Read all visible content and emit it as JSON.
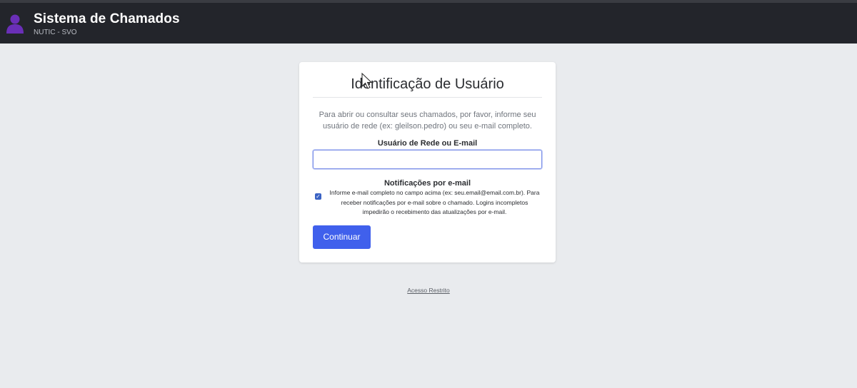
{
  "header": {
    "title": "Sistema de Chamados",
    "subtitle": "NUTIC - SVO",
    "avatar_icon": "user-silhouette-icon",
    "avatar_color": "#6a2fb8"
  },
  "card": {
    "title": "Identificação de Usuário",
    "intro": "Para abrir ou consultar seus chamados, por favor, informe seu usuário de rede (ex: gleilson.pedro) ou seu e-mail completo.",
    "field_label": "Usuário de Rede ou E-mail",
    "field_value": "",
    "notifications": {
      "title": "Notificações por e-mail",
      "checked": true,
      "check_icon": "checkmark-icon",
      "text": "Informe e-mail completo no campo acima (ex: seu.email@email.com.br). Para receber notificações por e-mail sobre o chamado. Logins incompletos impedirão o recebimento das atualizações por e-mail."
    },
    "continue_label": "Continuar",
    "accent_color": "#4060ec"
  },
  "footer": {
    "restricted_link": "Acesso Restrito"
  }
}
